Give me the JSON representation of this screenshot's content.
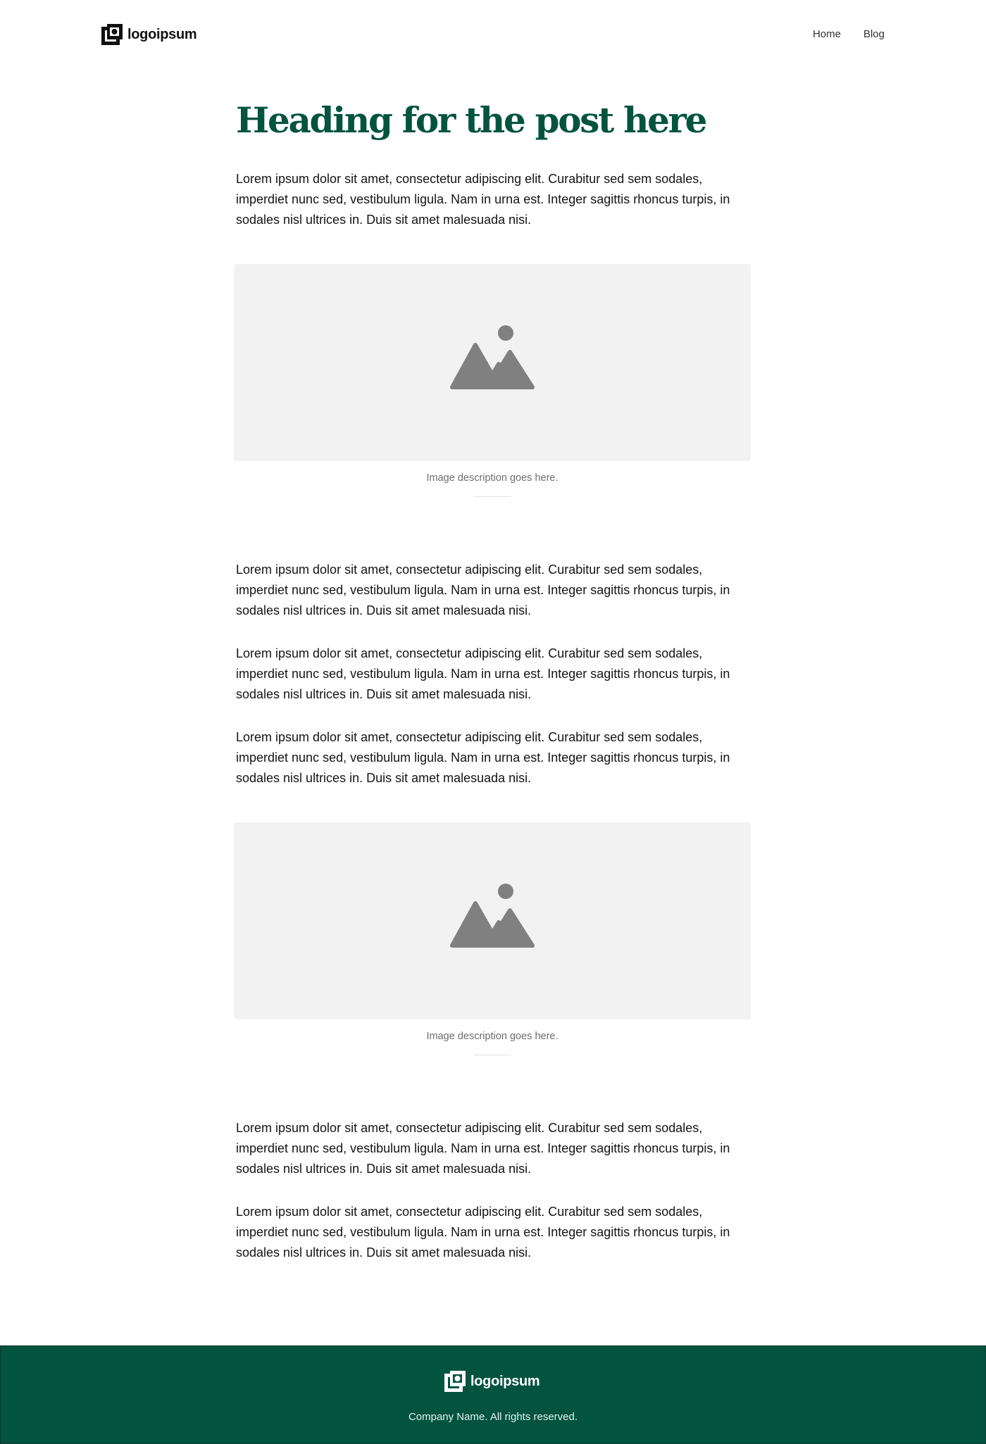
{
  "header": {
    "logo_text": "logoipsum",
    "nav": [
      {
        "label": "Home"
      },
      {
        "label": "Blog"
      }
    ]
  },
  "post": {
    "title": "Heading for the post here",
    "paragraphs": [
      "Lorem ipsum dolor sit amet, consectetur adipiscing elit. Curabitur sed sem sodales, imperdiet nunc sed, vestibulum ligula. Nam in urna est. Integer sagittis rhoncus turpis, in sodales nisl ultrices in. Duis sit amet malesuada nisi.",
      "Lorem ipsum dolor sit amet, consectetur adipiscing elit. Curabitur sed sem sodales, imperdiet nunc sed, vestibulum ligula. Nam in urna est. Integer sagittis rhoncus turpis, in sodales nisl ultrices in. Duis sit amet malesuada nisi.",
      "Lorem ipsum dolor sit amet, consectetur adipiscing elit. Curabitur sed sem sodales, imperdiet nunc sed, vestibulum ligula. Nam in urna est. Integer sagittis rhoncus turpis, in sodales nisl ultrices in. Duis sit amet malesuada nisi.",
      "Lorem ipsum dolor sit amet, consectetur adipiscing elit. Curabitur sed sem sodales, imperdiet nunc sed, vestibulum ligula. Nam in urna est. Integer sagittis rhoncus turpis, in sodales nisl ultrices in. Duis sit amet malesuada nisi.",
      "Lorem ipsum dolor sit amet, consectetur adipiscing elit. Curabitur sed sem sodales, imperdiet nunc sed, vestibulum ligula. Nam in urna est. Integer sagittis rhoncus turpis, in sodales nisl ultrices in. Duis sit amet malesuada nisi.",
      "Lorem ipsum dolor sit amet, consectetur adipiscing elit. Curabitur sed sem sodales, imperdiet nunc sed, vestibulum ligula. Nam in urna est. Integer sagittis rhoncus turpis, in sodales nisl ultrices in. Duis sit amet malesuada nisi."
    ],
    "figures": [
      {
        "icon": "image-placeholder-icon",
        "caption": "Image description goes here."
      },
      {
        "icon": "image-placeholder-icon",
        "caption": "Image description goes here."
      }
    ]
  },
  "footer": {
    "logo_text": "logoipsum",
    "copyright": "Company Name. All rights reserved."
  },
  "colors": {
    "brand": "#03543f",
    "placeholder_bg": "#f2f2f2",
    "placeholder_icon": "#808080"
  }
}
